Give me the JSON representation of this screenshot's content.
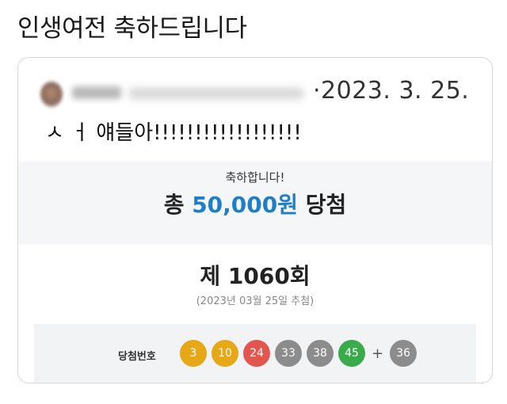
{
  "headline": "인생여전 축하드립니다",
  "post": {
    "date": "·2023. 3. 25.",
    "body": "ㅅ ㅓ 얘들아!!!!!!!!!!!!!!!!!!"
  },
  "result": {
    "congrats": "축하합니다!",
    "prefix": "총",
    "amount": "50,000원",
    "suffix": "당첨"
  },
  "draw": {
    "round": "제 1060회",
    "date": "(2023년 03월 25일 추첨)",
    "label": "당첨번호",
    "numbers": [
      {
        "value": "3",
        "color": "#e6a817"
      },
      {
        "value": "10",
        "color": "#e6a817"
      },
      {
        "value": "24",
        "color": "#e2564f"
      },
      {
        "value": "33",
        "color": "#8c8c8c"
      },
      {
        "value": "38",
        "color": "#8c8c8c"
      },
      {
        "value": "45",
        "color": "#3aab4a"
      }
    ],
    "plus": "+",
    "bonus": {
      "value": "36",
      "color": "#8c8c8c"
    }
  }
}
